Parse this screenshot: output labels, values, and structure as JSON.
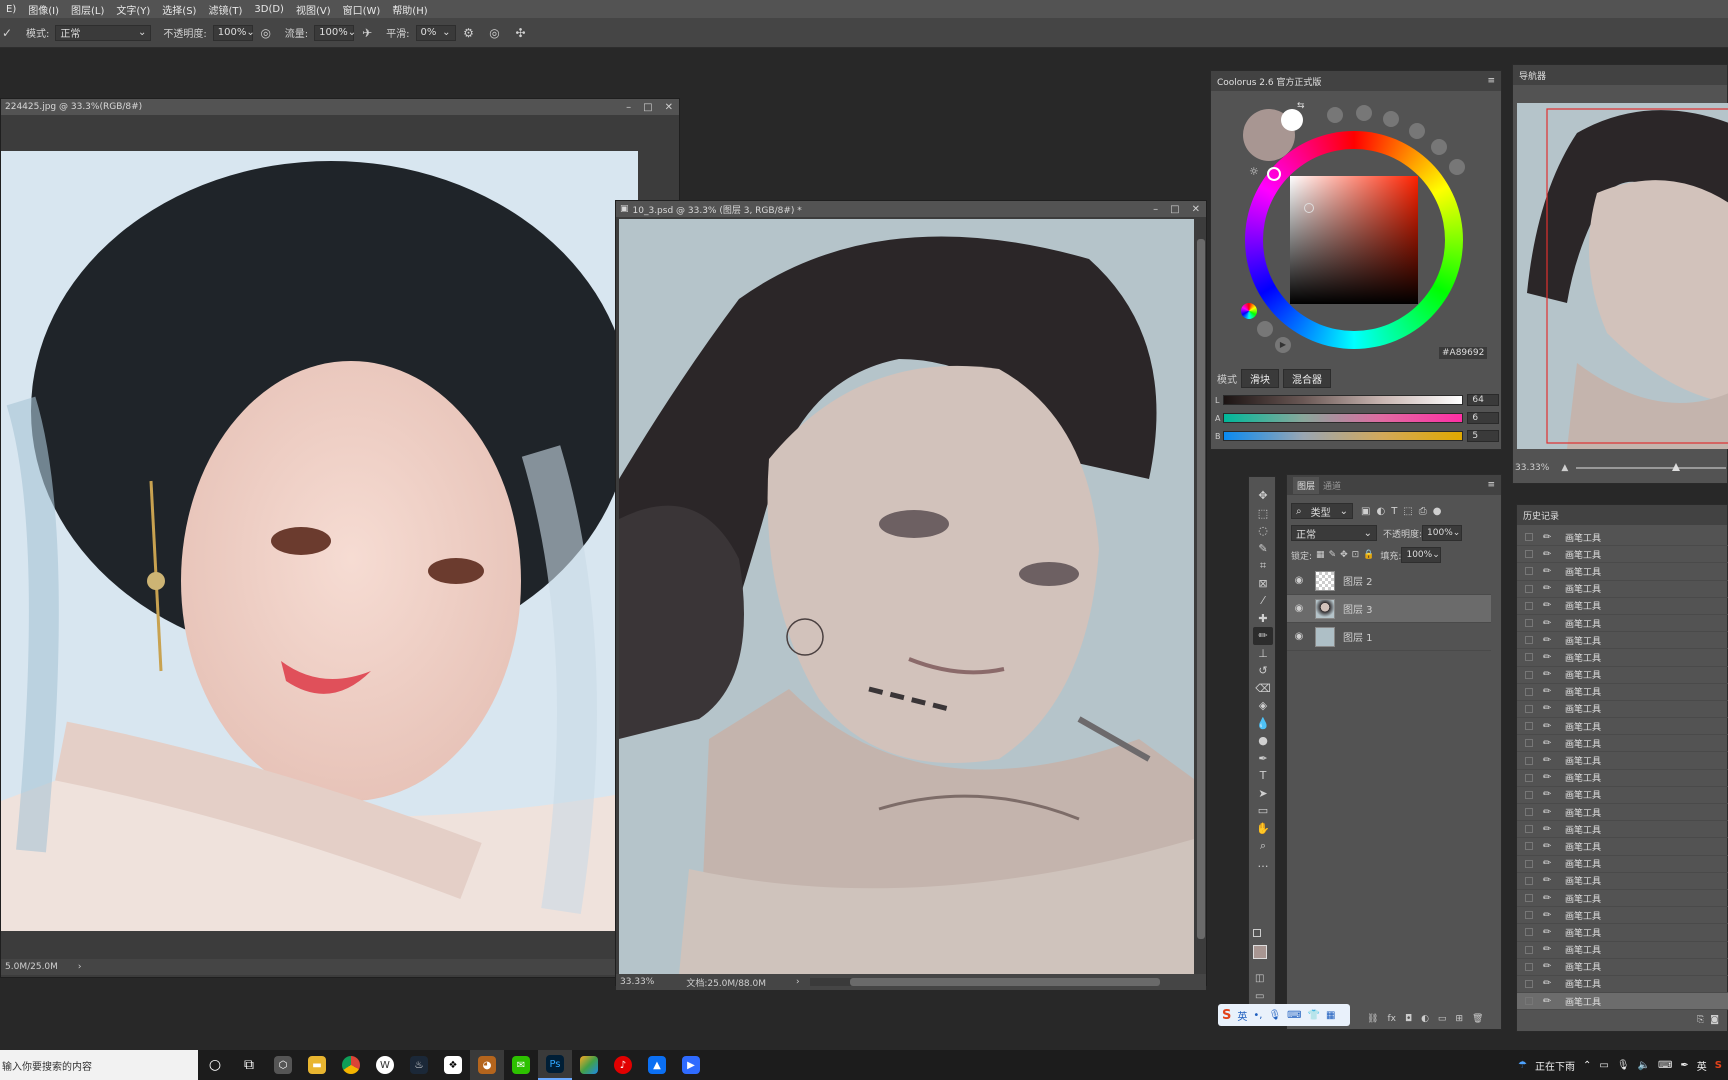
{
  "menu": [
    "E)",
    "图像(I)",
    "图层(L)",
    "文字(Y)",
    "选择(S)",
    "滤镜(T)",
    "3D(D)",
    "视图(V)",
    "窗口(W)",
    "帮助(H)"
  ],
  "options": {
    "mode_label": "模式:",
    "mode_value": "正常",
    "opacity_label": "不透明度:",
    "opacity_value": "100%",
    "flow_label": "流量:",
    "flow_value": "100%",
    "smooth_label": "平滑:",
    "smooth_value": "0%"
  },
  "doc1": {
    "title": "224425.jpg @ 33.3%(RGB/8#)",
    "status": "5.0M/25.0M"
  },
  "doc2": {
    "title": "10_3.psd @ 33.3% (图层 3, RGB/8#) *",
    "zoom": "33.33%",
    "docsize": "文档:25.0M/88.0M"
  },
  "coolorus": {
    "title": "Coolorus 2.6 官方正式版",
    "hex": "A89692",
    "mode_label": "模式",
    "btn_slider": "滑块",
    "btn_mixer": "混合器",
    "sliders": [
      {
        "label": "L",
        "value": "64"
      },
      {
        "label": "A",
        "value": "6"
      },
      {
        "label": "B",
        "value": "5"
      }
    ],
    "current_color": "#a89692"
  },
  "navigator": {
    "title": "导航器",
    "zoom": "33.33%"
  },
  "layers": {
    "tab_layers": "图层",
    "tab_channels": "通道",
    "filter": "类型",
    "blend": "正常",
    "opacity_label": "不透明度:",
    "opacity_value": "100%",
    "lock_label": "锁定:",
    "fill_label": "填充:",
    "fill_value": "100%",
    "items": [
      {
        "name": "图层 2"
      },
      {
        "name": "图层 3"
      },
      {
        "name": "图层 1"
      }
    ]
  },
  "history": {
    "title": "历史记录",
    "items": [
      "画笔工具",
      "画笔工具",
      "画笔工具",
      "画笔工具",
      "画笔工具",
      "画笔工具",
      "画笔工具",
      "画笔工具",
      "画笔工具",
      "画笔工具",
      "画笔工具",
      "画笔工具",
      "画笔工具",
      "画笔工具",
      "画笔工具",
      "画笔工具",
      "画笔工具",
      "画笔工具",
      "画笔工具",
      "画笔工具",
      "画笔工具",
      "画笔工具",
      "画笔工具",
      "画笔工具",
      "画笔工具",
      "画笔工具",
      "画笔工具",
      "画笔工具"
    ]
  },
  "ime": {
    "label": "英"
  },
  "taskbar": {
    "search_placeholder": "输入你要搜索的内容",
    "weather": "正在下雨",
    "lang": "英"
  }
}
